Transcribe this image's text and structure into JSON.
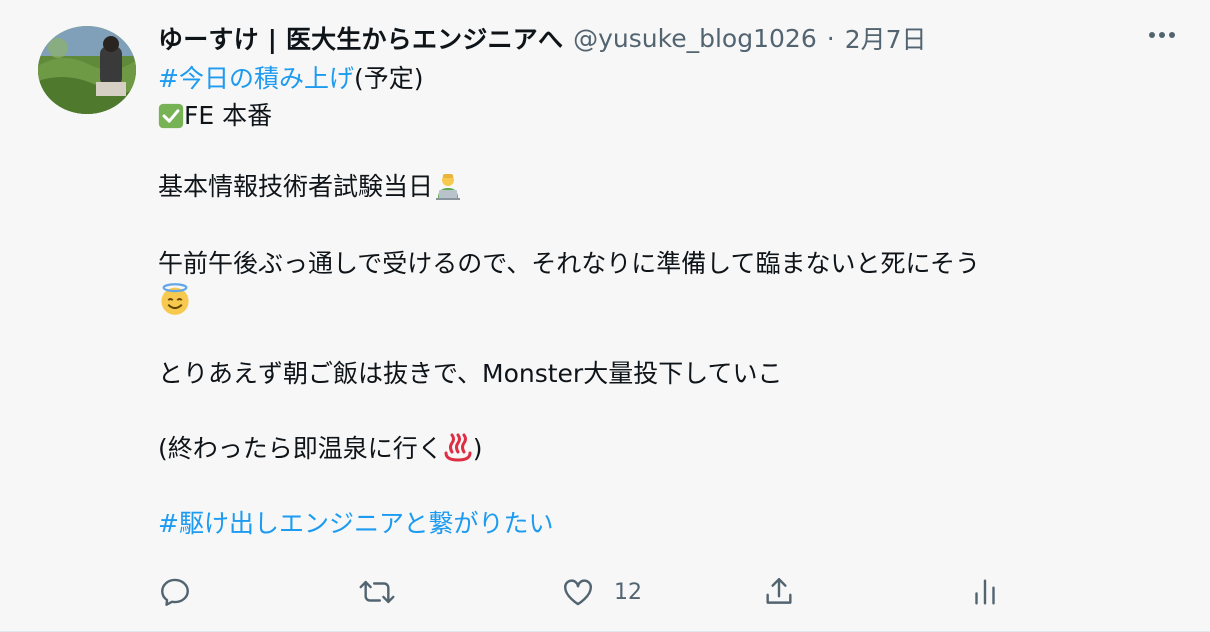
{
  "tweet": {
    "author": {
      "display_name": "ゆーすけ | 医大生からエンジニアへ",
      "handle": "@yusuke_blog1026",
      "separator": "·",
      "date": "2月7日"
    },
    "hashtag_top": "#今日の積み上げ",
    "hashtag_top_suffix": "(予定)",
    "check_line_text": "FE 本番",
    "line_exam": "基本情報技術者試験当日",
    "line_plan": "午前午後ぶっ通しで受けるので、それなりに準備して臨まないと死にそう",
    "line_breakfast": "とりあえず朝ご飯は抜きで、Monster大量投下していこ",
    "line_onsen_open": "(終わったら即温泉に行く",
    "line_onsen_close": ")",
    "hashtag_bottom": "#駆け出しエンジニアと繋がりたい",
    "icons": {
      "more": "more-icon",
      "check": "check-mark-button-icon",
      "laptop_person": "technologist-icon",
      "halo": "smiling-face-with-halo-icon",
      "hotspring": "hot-springs-icon"
    }
  },
  "actions": {
    "reply": {
      "icon": "reply-icon"
    },
    "retweet": {
      "icon": "retweet-icon"
    },
    "like": {
      "icon": "heart-icon",
      "count": "12"
    },
    "share": {
      "icon": "share-icon"
    },
    "analytics": {
      "icon": "analytics-icon"
    }
  },
  "colors": {
    "link": "#1d9bf0",
    "secondary": "#536471",
    "background": "#f7f7f7"
  }
}
